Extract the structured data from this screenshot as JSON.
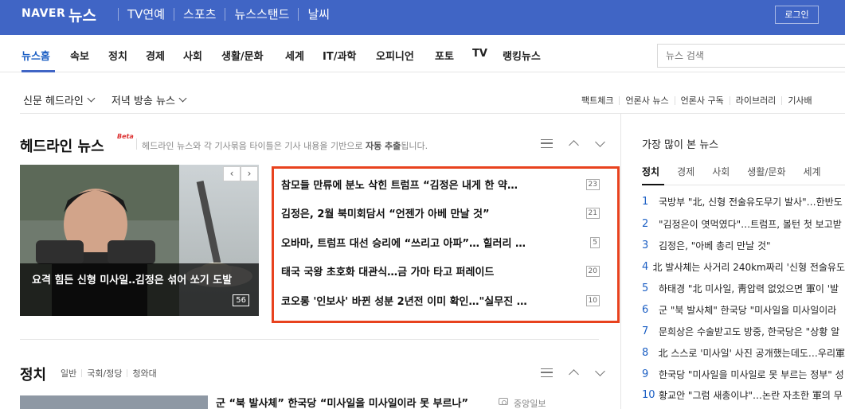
{
  "header": {
    "logo": "NAVER",
    "brand": "뉴스",
    "nav": [
      "TV연예",
      "스포츠",
      "뉴스스탠드",
      "날씨"
    ],
    "login_label": "로그인",
    "colors": {
      "bar": "#4065c5",
      "accent": "#1c5fc4",
      "highlight_border": "#e8421e"
    }
  },
  "categories": [
    "뉴스홈",
    "속보",
    "정치",
    "경제",
    "사회",
    "생활/문화",
    "세계",
    "IT/과학",
    "오피니언",
    "포토",
    "TV",
    "랭킹뉴스"
  ],
  "search": {
    "placeholder": "뉴스 검색"
  },
  "subnav": {
    "left": [
      "신문 헤드라인",
      "저녁 방송 뉴스"
    ],
    "right": [
      "팩트체크",
      "언론사 뉴스",
      "언론사 구독",
      "라이브러리",
      "기사배"
    ]
  },
  "headline": {
    "title": "헤드라인 뉴스",
    "badge": "Beta",
    "desc_pre": "헤드라인 뉴스와 각 기사묶음 타이틀은 기사 내용을 기반으로 ",
    "desc_bold": "자동 추출",
    "desc_post": "됩니다.",
    "photo_caption": "요격 힘든 신형 미사일‥김정은 섞어 쏘기 도발",
    "photo_count": "56",
    "pager_prev": "‹",
    "pager_next": "›",
    "items": [
      {
        "title": "참모들 만류에 분노 삭힌 트럼프 “김정은 내게 한 약…",
        "count": "23"
      },
      {
        "title": "김정은, 2월 북미회담서 “언젠가 아베 만날 것”",
        "count": "21"
      },
      {
        "title": "오바마, 트럼프 대선 승리에 “쓰리고 아파”… 힐러리 …",
        "count": "5"
      },
      {
        "title": "태국 국왕 초호화 대관식…금 가마 타고 퍼레이드",
        "count": "20"
      },
      {
        "title": "코오롱 '인보사' 바뀐 성분 2년전 이미 확인…\"실무진 …",
        "count": "10"
      }
    ]
  },
  "politics": {
    "title": "정치",
    "tabs": [
      "일반",
      "국회/정당",
      "청와대"
    ],
    "headline": "군 “북 발사체” 한국당 “미사일을 미사일이라 못 부르나”",
    "press": "중앙일보"
  },
  "most_viewed": {
    "title": "가장 많이 본 뉴스",
    "tabs": [
      "정치",
      "경제",
      "사회",
      "생활/문화",
      "세계"
    ],
    "items": [
      {
        "n": "1",
        "title": "국방부 \"北, 신형 전술유도무기 발사\"…한반도"
      },
      {
        "n": "2",
        "title": "\"김정은이 엿먹였다\"…트럼프, 볼턴 첫 보고받"
      },
      {
        "n": "3",
        "title": "김정은, \"아베 총리 만날 것\""
      },
      {
        "n": "4",
        "title": "北 발사체는 사거리 240km짜리 '신형 전술유도"
      },
      {
        "n": "5",
        "title": "하태경 \"北 미사일, 靑압력 없었으면 軍이 '발"
      },
      {
        "n": "6",
        "title": "군 \"북 발사체\" 한국당 \"미사일을 미사일이라"
      },
      {
        "n": "7",
        "title": "문희상은 수술받고도 방중, 한국당은 \"상황 알"
      },
      {
        "n": "8",
        "title": "北 스스로 '미사일' 사진 공개했는데도…우리軍"
      },
      {
        "n": "9",
        "title": "한국당 \"미사일을 미사일로 못 부르는 정부\" 성"
      },
      {
        "n": "10",
        "title": "황교안 \"그럼 새총이냐\"…논란 자초한 軍의 무"
      }
    ]
  }
}
